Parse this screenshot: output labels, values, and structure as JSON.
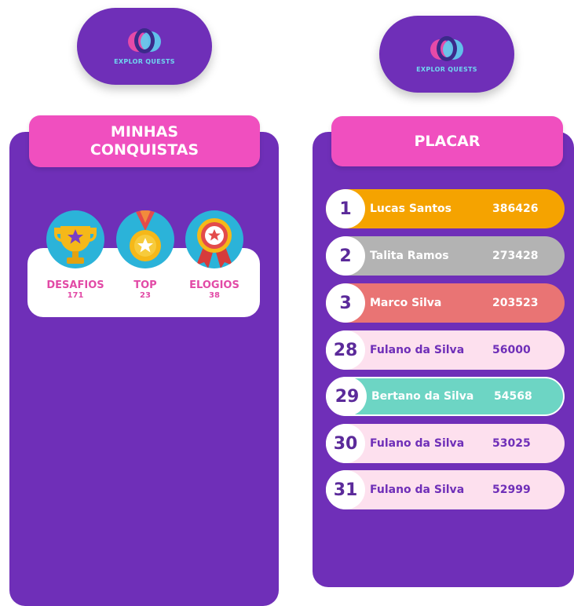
{
  "brand": {
    "name": "EXPLOR QUESTS"
  },
  "colors": {
    "purple": "#6f2fb8",
    "pink": "#f04fbf",
    "gold": "#f5a300",
    "silver": "#b3b3b3",
    "bronze": "#e97474",
    "highlight": "#6dd5c4",
    "light": "#fde0ee"
  },
  "achievements": {
    "title": "MINHAS CONQUISTAS",
    "items": [
      {
        "label": "DESAFIOS",
        "count": "171",
        "icon": "trophy-icon"
      },
      {
        "label": "TOP",
        "count": "23",
        "icon": "medal-icon"
      },
      {
        "label": "ELOGIOS",
        "count": "38",
        "icon": "ribbon-icon"
      }
    ]
  },
  "leaderboard": {
    "title": "PLACAR",
    "rows": [
      {
        "rank": "1",
        "name": "Lucas Santos",
        "score": "386426"
      },
      {
        "rank": "2",
        "name": "Talita Ramos",
        "score": "273428"
      },
      {
        "rank": "3",
        "name": "Marco Silva",
        "score": "203523"
      },
      {
        "rank": "28",
        "name": "Fulano da Silva",
        "score": "56000"
      },
      {
        "rank": "29",
        "name": "Bertano da Silva",
        "score": "54568"
      },
      {
        "rank": "30",
        "name": "Fulano da Silva",
        "score": "53025"
      },
      {
        "rank": "31",
        "name": "Fulano da Silva",
        "score": "52999"
      }
    ]
  }
}
